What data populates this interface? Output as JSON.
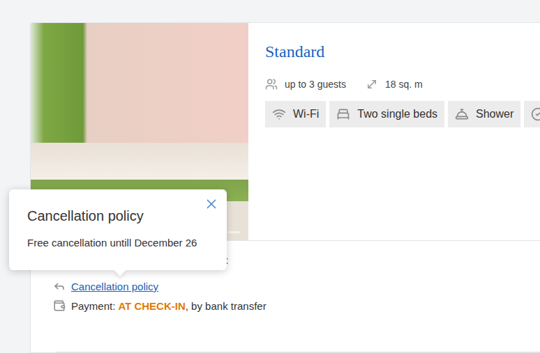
{
  "room": {
    "title": "Standard",
    "guests": "up to 3 guests",
    "area": "18 sq. m",
    "amenities": [
      {
        "label": "Wi-Fi",
        "kind": "wifi"
      },
      {
        "label": "Two single beds",
        "kind": "beds"
      },
      {
        "label": "Shower",
        "kind": "shower"
      },
      {
        "label": "",
        "kind": "check"
      }
    ]
  },
  "offer": {
    "meal": "st",
    "cancellation_link": "Cancellation policy",
    "payment_label": "Payment:",
    "payment_time": "AT CHECK-IN",
    "payment_method": ", by bank transfer"
  },
  "tooltip": {
    "title": "Cancellation policy",
    "text": "Free cancellation untill December 26"
  }
}
